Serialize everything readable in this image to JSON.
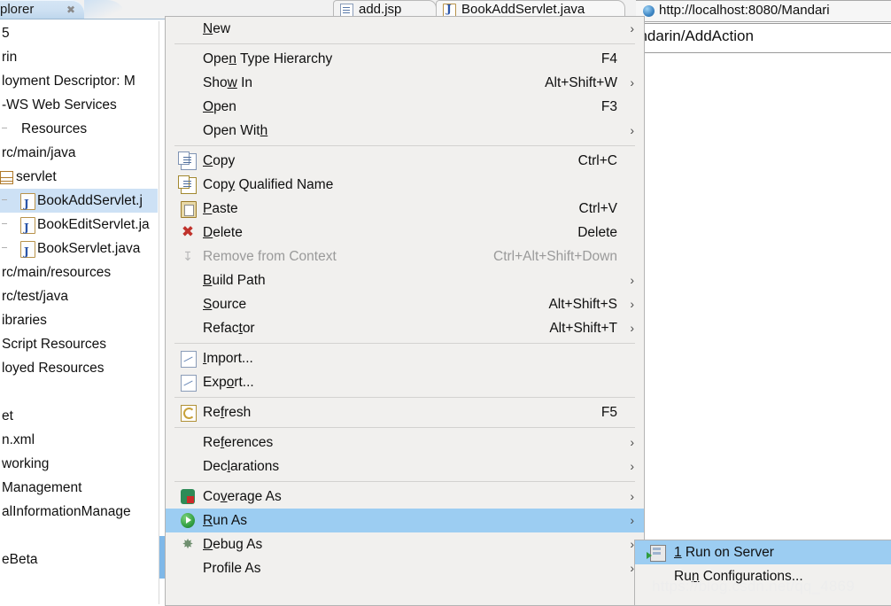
{
  "explorer": {
    "tab_label": "plorer",
    "close_icon": "close-icon",
    "toolbar": [
      {
        "name": "collapse-all-icon"
      },
      {
        "name": "link-with-editor-icon"
      },
      {
        "name": "filters-icon"
      },
      {
        "name": "view-menu-icon"
      },
      {
        "name": "minimize-icon"
      },
      {
        "name": "maximize-icon"
      }
    ],
    "tree": [
      {
        "label": "5",
        "indent": 0,
        "icon": "none",
        "selected": false
      },
      {
        "label": "rin",
        "indent": 0,
        "icon": "none",
        "selected": false
      },
      {
        "label": "loyment Descriptor: M",
        "indent": 0,
        "icon": "none",
        "selected": false
      },
      {
        "label": "-WS Web Services",
        "indent": 0,
        "icon": "none",
        "selected": false
      },
      {
        "label": "Resources",
        "indent": 2,
        "icon": "none",
        "selected": false
      },
      {
        "label": "rc/main/java",
        "indent": 0,
        "icon": "none",
        "selected": false
      },
      {
        "label": "servlet",
        "indent": 0,
        "icon": "package-icon",
        "selected": false
      },
      {
        "label": "BookAddServlet.j",
        "indent": 20,
        "icon": "java-file-icon",
        "selected": true
      },
      {
        "label": "BookEditServlet.ja",
        "indent": 20,
        "icon": "java-file-icon",
        "selected": false
      },
      {
        "label": "BookServlet.java",
        "indent": 20,
        "icon": "java-file-icon",
        "selected": false
      },
      {
        "label": "rc/main/resources",
        "indent": 0,
        "icon": "none",
        "selected": false
      },
      {
        "label": "rc/test/java",
        "indent": 0,
        "icon": "none",
        "selected": false
      },
      {
        "label": "ibraries",
        "indent": 0,
        "icon": "none",
        "selected": false
      },
      {
        "label": "Script Resources",
        "indent": 0,
        "icon": "none",
        "selected": false
      },
      {
        "label": "loyed Resources",
        "indent": 0,
        "icon": "none",
        "selected": false
      },
      {
        "label": "",
        "indent": 0,
        "icon": "none",
        "selected": false
      },
      {
        "label": "et",
        "indent": 0,
        "icon": "none",
        "selected": false
      },
      {
        "label": "n.xml",
        "indent": 0,
        "icon": "none",
        "selected": false
      },
      {
        "label": "working",
        "indent": 0,
        "icon": "none",
        "selected": false
      },
      {
        "label": "Management",
        "indent": 0,
        "icon": "none",
        "selected": false
      },
      {
        "label": "alInformationManage",
        "indent": 0,
        "icon": "none",
        "selected": false
      },
      {
        "label": "",
        "indent": 0,
        "icon": "none",
        "selected": false
      },
      {
        "label": "eBeta",
        "indent": 0,
        "icon": "none",
        "selected": false
      }
    ]
  },
  "editor_tabs": [
    {
      "label": "add.jsp",
      "icon": "jsp-file-icon"
    },
    {
      "label": "BookAddServlet.java",
      "icon": "java-file-icon"
    }
  ],
  "browser": {
    "tab_label": "http://localhost:8080/Mandari",
    "tab_icon": "globe-icon",
    "url_text": "andarin/AddAction"
  },
  "context_menu": {
    "items": [
      {
        "label": "New",
        "mnemonic": "N",
        "accel": "",
        "arrow": true,
        "icon": "none",
        "disabled": false,
        "highlighted": false
      },
      {
        "sep": true
      },
      {
        "label": "Open Type Hierarchy",
        "mnemonic": "n",
        "accel": "F4",
        "arrow": false,
        "icon": "none",
        "disabled": false,
        "highlighted": false
      },
      {
        "label": "Show In",
        "mnemonic": "w",
        "accel": "Alt+Shift+W",
        "arrow": true,
        "icon": "none",
        "disabled": false,
        "highlighted": false
      },
      {
        "label": "Open",
        "mnemonic": "O",
        "accel": "F3",
        "arrow": false,
        "icon": "none",
        "disabled": false,
        "highlighted": false
      },
      {
        "label": "Open With",
        "mnemonic": "h",
        "accel": "",
        "arrow": true,
        "icon": "none",
        "disabled": false,
        "highlighted": false
      },
      {
        "sep": true
      },
      {
        "label": "Copy",
        "mnemonic": "C",
        "accel": "Ctrl+C",
        "arrow": false,
        "icon": "copy-icon",
        "disabled": false,
        "highlighted": false
      },
      {
        "label": "Copy Qualified Name",
        "mnemonic": "y",
        "accel": "",
        "arrow": false,
        "icon": "copy-qualified-name-icon",
        "disabled": false,
        "highlighted": false
      },
      {
        "label": "Paste",
        "mnemonic": "P",
        "accel": "Ctrl+V",
        "arrow": false,
        "icon": "paste-icon",
        "disabled": false,
        "highlighted": false
      },
      {
        "label": "Delete",
        "mnemonic": "D",
        "accel": "Delete",
        "arrow": false,
        "icon": "delete-icon",
        "disabled": false,
        "highlighted": false
      },
      {
        "label": "Remove from Context",
        "mnemonic": "",
        "accel": "Ctrl+Alt+Shift+Down",
        "arrow": false,
        "icon": "remove-from-context-icon",
        "disabled": true,
        "highlighted": false
      },
      {
        "label": "Build Path",
        "mnemonic": "B",
        "accel": "",
        "arrow": true,
        "icon": "none",
        "disabled": false,
        "highlighted": false
      },
      {
        "label": "Source",
        "mnemonic": "S",
        "accel": "Alt+Shift+S",
        "arrow": true,
        "icon": "none",
        "disabled": false,
        "highlighted": false
      },
      {
        "label": "Refactor",
        "mnemonic": "t",
        "accel": "Alt+Shift+T",
        "arrow": true,
        "icon": "none",
        "disabled": false,
        "highlighted": false
      },
      {
        "sep": true
      },
      {
        "label": "Import...",
        "mnemonic": "I",
        "accel": "",
        "arrow": false,
        "icon": "import-icon",
        "disabled": false,
        "highlighted": false
      },
      {
        "label": "Export...",
        "mnemonic": "o",
        "accel": "",
        "arrow": false,
        "icon": "export-icon",
        "disabled": false,
        "highlighted": false
      },
      {
        "sep": true
      },
      {
        "label": "Refresh",
        "mnemonic": "f",
        "accel": "F5",
        "arrow": false,
        "icon": "refresh-icon",
        "disabled": false,
        "highlighted": false
      },
      {
        "sep": true
      },
      {
        "label": "References",
        "mnemonic": "f",
        "accel": "",
        "arrow": true,
        "icon": "none",
        "disabled": false,
        "highlighted": false
      },
      {
        "label": "Declarations",
        "mnemonic": "l",
        "accel": "",
        "arrow": true,
        "icon": "none",
        "disabled": false,
        "highlighted": false
      },
      {
        "sep": true
      },
      {
        "label": "Coverage As",
        "mnemonic": "v",
        "accel": "",
        "arrow": true,
        "icon": "coverage-icon",
        "disabled": false,
        "highlighted": false
      },
      {
        "label": "Run As",
        "mnemonic": "R",
        "accel": "",
        "arrow": true,
        "icon": "run-icon",
        "disabled": false,
        "highlighted": true
      },
      {
        "label": "Debug As",
        "mnemonic": "D",
        "accel": "",
        "arrow": true,
        "icon": "debug-icon",
        "disabled": false,
        "highlighted": false
      },
      {
        "label": "Profile As",
        "mnemonic": "",
        "accel": "",
        "arrow": true,
        "icon": "none",
        "disabled": false,
        "highlighted": false
      }
    ]
  },
  "submenu": {
    "items": [
      {
        "label": "1 Run on Server",
        "mnemonic": "1",
        "accel": "",
        "icon": "run-on-server-icon",
        "highlighted": true
      },
      {
        "label": "Run Configurations...",
        "mnemonic": "n",
        "accel": "",
        "icon": "none",
        "highlighted": false
      }
    ]
  },
  "watermark": {
    "text": "https://blog.csdn.net/qq_4869"
  },
  "colors": {
    "menu_bg": "#f1f0ee",
    "highlight": "#9ccdf2",
    "tree_selection": "#cde1f5",
    "scrollbar_thumb": "#7fb8e8"
  }
}
